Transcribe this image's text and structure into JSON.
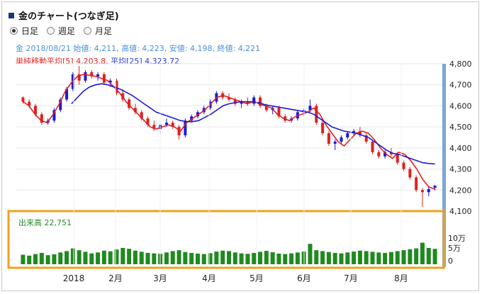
{
  "header": {
    "title": "金のチャート(つなぎ足)"
  },
  "period_options": [
    {
      "label": "日足",
      "selected": true
    },
    {
      "label": "週足",
      "selected": false
    },
    {
      "label": "月足",
      "selected": false
    }
  ],
  "info_line": "金 2018/08/21 始値: 4,211, 高値: 4,223, 安値: 4,198, 終値: 4,221",
  "ma_legend": {
    "ma5": "単純移動平均[5] 4,203.8,",
    "ma25": "平均[25] 4,323.72"
  },
  "volume_label": "出来高 22,751",
  "colors": {
    "up": "#1a1ad8",
    "down": "#e02020",
    "ma5": "#e02020",
    "ma25": "#1a1ad8",
    "volume": "#1f8a1f",
    "highlight": "#f0a020",
    "axis": "#7aa7d8"
  },
  "chart_data": {
    "type": "line",
    "y_ticks": [
      "4,800",
      "4,700",
      "4,600",
      "4,500",
      "4,400",
      "4,300",
      "4,200",
      "4,100"
    ],
    "ylim": [
      4100,
      4800
    ],
    "x_ticks": [
      "2018",
      "2月",
      "3月",
      "4月",
      "5月",
      "6月",
      "7月",
      "8月"
    ],
    "volume_ticks": [
      "10万",
      "5万",
      "0"
    ],
    "volume_max": 150000,
    "series": [
      {
        "name": "単純移動平均[5]",
        "values": [
          4620,
          4600,
          4560,
          4530,
          4520,
          4560,
          4610,
          4670,
          4710,
          4740,
          4750,
          4745,
          4740,
          4730,
          4720,
          4690,
          4660,
          4620,
          4590,
          4560,
          4530,
          4500,
          4490,
          4500,
          4510,
          4500,
          4480,
          4520,
          4540,
          4560,
          4580,
          4610,
          4640,
          4650,
          4640,
          4630,
          4620,
          4610,
          4620,
          4610,
          4600,
          4590,
          4560,
          4540,
          4530,
          4550,
          4560,
          4570,
          4590,
          4560,
          4510,
          4470,
          4430,
          4410,
          4440,
          4470,
          4480,
          4470,
          4440,
          4400,
          4370,
          4350,
          4380,
          4370,
          4340,
          4300,
          4250,
          4215,
          4204
        ]
      },
      {
        "name": "平均[25]",
        "values": [
          null,
          null,
          null,
          null,
          null,
          null,
          null,
          null,
          4610,
          4640,
          4670,
          4690,
          4700,
          4705,
          4700,
          4690,
          4680,
          4665,
          4650,
          4630,
          4610,
          4590,
          4570,
          4560,
          4550,
          4540,
          4530,
          4525,
          4525,
          4530,
          4545,
          4560,
          4580,
          4600,
          4610,
          4615,
          4620,
          4620,
          4620,
          4615,
          4605,
          4600,
          4595,
          4590,
          4585,
          4580,
          4575,
          4570,
          4560,
          4540,
          4520,
          4500,
          4490,
          4480,
          4475,
          4470,
          4460,
          4450,
          4430,
          4410,
          4390,
          4375,
          4370,
          4360,
          4350,
          4340,
          4330,
          4326,
          4324
        ]
      }
    ],
    "candles": [
      [
        4640,
        4645,
        4610,
        4620
      ],
      [
        4620,
        4630,
        4590,
        4600
      ],
      [
        4600,
        4610,
        4550,
        4560
      ],
      [
        4560,
        4570,
        4510,
        4520
      ],
      [
        4520,
        4540,
        4510,
        4530
      ],
      [
        4530,
        4590,
        4520,
        4580
      ],
      [
        4580,
        4640,
        4570,
        4630
      ],
      [
        4630,
        4690,
        4620,
        4680
      ],
      [
        4680,
        4760,
        4670,
        4750
      ],
      [
        4750,
        4790,
        4700,
        4720
      ],
      [
        4720,
        4770,
        4710,
        4760
      ],
      [
        4760,
        4770,
        4730,
        4740
      ],
      [
        4740,
        4760,
        4720,
        4750
      ],
      [
        4750,
        4760,
        4700,
        4710
      ],
      [
        4710,
        4730,
        4690,
        4720
      ],
      [
        4720,
        4730,
        4650,
        4660
      ],
      [
        4660,
        4680,
        4620,
        4630
      ],
      [
        4630,
        4640,
        4580,
        4590
      ],
      [
        4590,
        4610,
        4560,
        4570
      ],
      [
        4570,
        4580,
        4530,
        4540
      ],
      [
        4540,
        4550,
        4500,
        4510
      ],
      [
        4510,
        4530,
        4480,
        4490
      ],
      [
        4490,
        4520,
        4470,
        4510
      ],
      [
        4510,
        4540,
        4500,
        4520
      ],
      [
        4520,
        4530,
        4490,
        4500
      ],
      [
        4500,
        4510,
        4440,
        4460
      ],
      [
        4460,
        4540,
        4450,
        4530
      ],
      [
        4530,
        4560,
        4520,
        4550
      ],
      [
        4550,
        4580,
        4540,
        4570
      ],
      [
        4570,
        4600,
        4560,
        4590
      ],
      [
        4590,
        4630,
        4580,
        4620
      ],
      [
        4620,
        4670,
        4610,
        4660
      ],
      [
        4660,
        4670,
        4630,
        4640
      ],
      [
        4640,
        4660,
        4620,
        4630
      ],
      [
        4630,
        4640,
        4600,
        4610
      ],
      [
        4610,
        4630,
        4590,
        4620
      ],
      [
        4620,
        4640,
        4600,
        4610
      ],
      [
        4610,
        4650,
        4600,
        4640
      ],
      [
        4640,
        4650,
        4590,
        4600
      ],
      [
        4600,
        4610,
        4570,
        4580
      ],
      [
        4580,
        4600,
        4560,
        4590
      ],
      [
        4590,
        4600,
        4540,
        4550
      ],
      [
        4550,
        4560,
        4520,
        4530
      ],
      [
        4530,
        4550,
        4520,
        4540
      ],
      [
        4540,
        4580,
        4530,
        4570
      ],
      [
        4570,
        4590,
        4550,
        4580
      ],
      [
        4580,
        4630,
        4570,
        4600
      ],
      [
        4600,
        4610,
        4510,
        4520
      ],
      [
        4520,
        4530,
        4460,
        4470
      ],
      [
        4470,
        4480,
        4410,
        4420
      ],
      [
        4420,
        4440,
        4390,
        4430
      ],
      [
        4430,
        4460,
        4420,
        4450
      ],
      [
        4450,
        4480,
        4440,
        4470
      ],
      [
        4470,
        4490,
        4460,
        4480
      ],
      [
        4480,
        4500,
        4450,
        4460
      ],
      [
        4460,
        4470,
        4420,
        4430
      ],
      [
        4430,
        4440,
        4370,
        4380
      ],
      [
        4380,
        4390,
        4350,
        4360
      ],
      [
        4360,
        4390,
        4350,
        4380
      ],
      [
        4380,
        4400,
        4360,
        4370
      ],
      [
        4370,
        4380,
        4320,
        4330
      ],
      [
        4330,
        4340,
        4290,
        4300
      ],
      [
        4300,
        4310,
        4250,
        4260
      ],
      [
        4260,
        4270,
        4190,
        4200
      ],
      [
        4200,
        4210,
        4120,
        4190
      ],
      [
        4190,
        4215,
        4170,
        4205
      ],
      [
        4211,
        4223,
        4198,
        4221
      ]
    ],
    "volume": [
      42000,
      38000,
      45000,
      50000,
      40000,
      44000,
      52000,
      58000,
      70000,
      62000,
      55000,
      48000,
      52000,
      60000,
      57000,
      65000,
      72000,
      68000,
      60000,
      55000,
      50000,
      48000,
      46000,
      52000,
      58000,
      62000,
      54000,
      50000,
      47000,
      45000,
      49000,
      56000,
      60000,
      58000,
      52000,
      48000,
      46000,
      50000,
      55000,
      59000,
      53000,
      47000,
      45000,
      48000,
      52000,
      56000,
      90000,
      62000,
      58000,
      54000,
      50000,
      48000,
      52000,
      56000,
      60000,
      58000,
      55000,
      52000,
      50000,
      54000,
      58000,
      62000,
      66000,
      70000,
      95000,
      72000,
      68000
    ]
  }
}
